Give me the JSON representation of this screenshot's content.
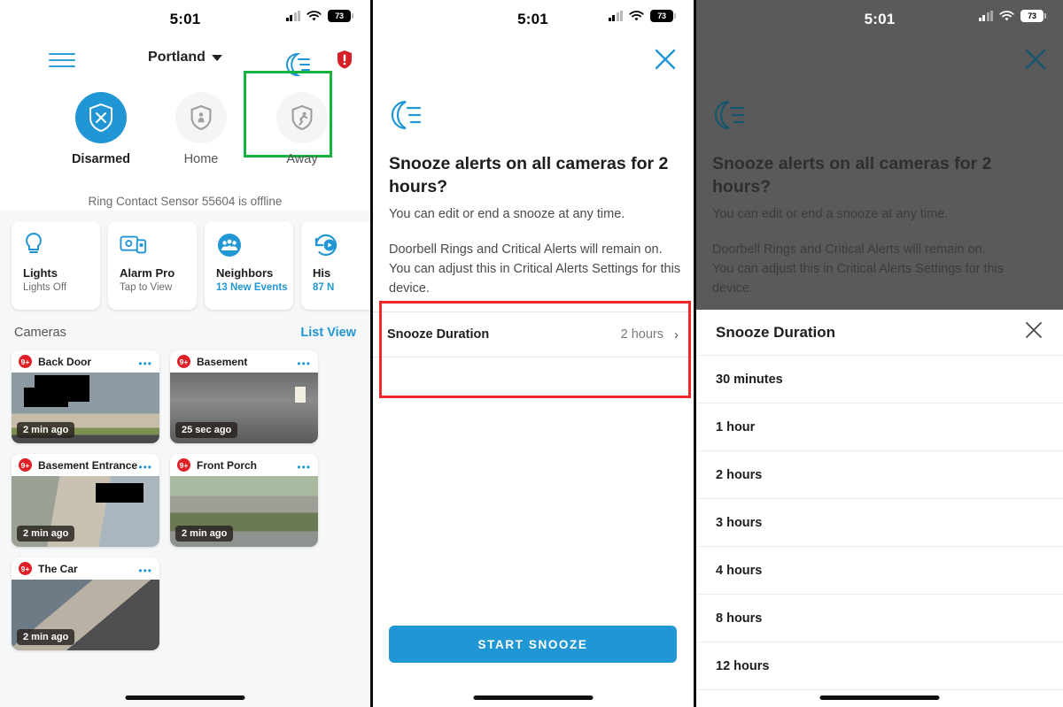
{
  "status_bar": {
    "time": "5:01",
    "battery": "73",
    "signal_icon": "cellular-signal-icon",
    "wifi_icon": "wifi-icon",
    "battery_icon": "battery-icon"
  },
  "panel1": {
    "menu_icon": "hamburger-menu-icon",
    "location": "Portland",
    "location_caret_icon": "chevron-down-icon",
    "snooze_icon": "moon-snooze-icon",
    "alert_icon": "alert-exclamation-icon",
    "highlight_color": "#16b33f",
    "modes": [
      {
        "label": "Disarmed",
        "icon": "shield-x-icon",
        "state": "active"
      },
      {
        "label": "Home",
        "icon": "shield-person-icon",
        "state": "idle"
      },
      {
        "label": "Away",
        "icon": "shield-running-icon",
        "state": "idle"
      }
    ],
    "offline_message": "Ring Contact Sensor 55604 is offline",
    "tiles": [
      {
        "name": "Lights",
        "sub": "Lights Off",
        "icon": "lightbulb-icon",
        "sub_accent": false
      },
      {
        "name": "Alarm Pro",
        "sub": "Tap to View",
        "icon": "alarm-pro-icon",
        "sub_accent": false
      },
      {
        "name": "Neighbors",
        "sub": "13 New Events",
        "icon": "neighbors-icon",
        "sub_accent": true
      },
      {
        "name": "His",
        "sub": "87 N",
        "icon": "history-icon",
        "sub_accent": true
      }
    ],
    "cameras_header": "Cameras",
    "list_view": "List View",
    "cameras": [
      {
        "name": "Back Door",
        "badge": "9+",
        "ago": "2 min ago",
        "thumb": "t-backdoor",
        "more_icon": "more-options-icon"
      },
      {
        "name": "Basement",
        "badge": "9+",
        "ago": "25 sec ago",
        "thumb": "t-basement",
        "more_icon": "more-options-icon"
      },
      {
        "name": "Basement Entrance",
        "badge": "9+",
        "ago": "2 min ago",
        "thumb": "t-bentrance",
        "more_icon": "more-options-icon"
      },
      {
        "name": "Front Porch",
        "badge": "9+",
        "ago": "2 min ago",
        "thumb": "t-frontporch",
        "more_icon": "more-options-icon"
      },
      {
        "name": "The Car",
        "badge": "9+",
        "ago": "2 min ago",
        "thumb": "t-thecar",
        "more_icon": "more-options-icon"
      }
    ]
  },
  "panel2": {
    "close_icon": "close-x-icon",
    "snooze_icon": "moon-snooze-icon",
    "title": "Snooze alerts on all cameras for 2 hours?",
    "paragraph1": "You can edit or end a snooze at any time.",
    "paragraph2": "Doorbell Rings and Critical Alerts will remain on. You can adjust this in Critical Alerts Settings for this device.",
    "duration_label": "Snooze Duration",
    "duration_value": "2 hours",
    "duration_chevron_icon": "chevron-right-icon",
    "highlight_color": "#ef2a2a",
    "primary_button": "START SNOOZE",
    "accent_color": "#2196d4"
  },
  "panel3": {
    "close_icon": "close-x-icon",
    "snooze_icon": "moon-snooze-icon",
    "title": "Snooze alerts on all cameras for 2 hours?",
    "paragraph1": "You can edit or end a snooze at any time.",
    "paragraph2": "Doorbell Rings and Critical Alerts will remain on. You can adjust this in Critical Alerts Settings for this device.",
    "sheet_title": "Snooze Duration",
    "sheet_close_icon": "close-x-icon",
    "options": [
      "30 minutes",
      "1 hour",
      "2 hours",
      "3 hours",
      "4 hours",
      "8 hours",
      "12 hours"
    ]
  }
}
